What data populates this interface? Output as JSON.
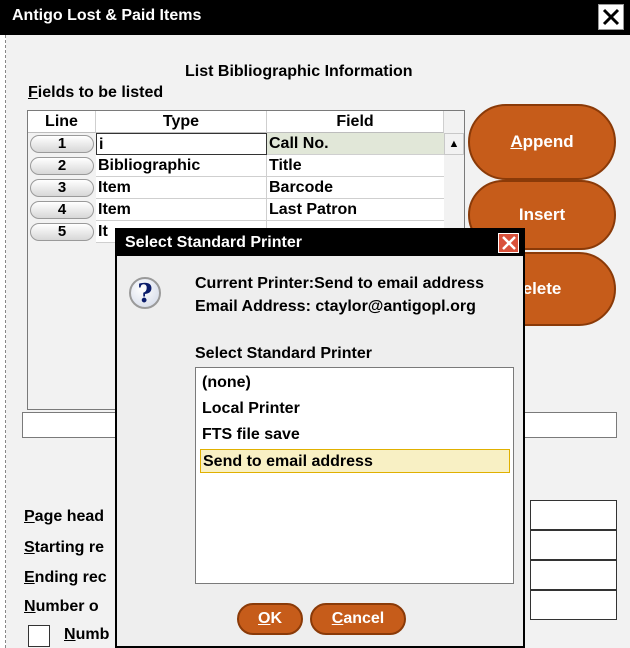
{
  "window": {
    "title": "Antigo Lost & Paid Items"
  },
  "list_heading": "List Bibliographic Information",
  "fields_label": {
    "mnemonic": "F",
    "rest": "ields to be listed"
  },
  "table": {
    "columns": [
      "Line",
      "Type",
      "Field"
    ],
    "rows": [
      {
        "line": "1",
        "type": "i",
        "field": "Call No."
      },
      {
        "line": "2",
        "type": "Bibliographic",
        "field": "Title"
      },
      {
        "line": "3",
        "type": "Item",
        "field": "Barcode"
      },
      {
        "line": "4",
        "type": "Item",
        "field": "Last Patron"
      },
      {
        "line": "5",
        "type": "It",
        "field": ""
      }
    ]
  },
  "buttons": {
    "append": {
      "mnemonic": "A",
      "rest": "ppend"
    },
    "insert": "Insert",
    "delete": "elete"
  },
  "bottom_labels": [
    {
      "mnemonic": "P",
      "rest": "age head"
    },
    {
      "mnemonic": "S",
      "rest": "tarting re"
    },
    {
      "mnemonic": "E",
      "rest": "nding rec"
    },
    {
      "mnemonic": "N",
      "rest": "umber o"
    }
  ],
  "numb_checkbox": {
    "mnemonic": "N",
    "rest": "umb"
  },
  "dialog": {
    "title": "Select Standard Printer",
    "icon": "question-icon",
    "current_printer": "Current Printer:Send to email address",
    "email": "Email Address: ctaylor@antigopl.org",
    "list_heading": "Select Standard Printer",
    "options": [
      "(none)",
      "Local Printer",
      "FTS file save",
      "Send to email address"
    ],
    "selected_option": "Send to email address",
    "ok": {
      "mnemonic": "O",
      "rest": "K"
    },
    "cancel": {
      "mnemonic": "C",
      "rest": "ancel"
    }
  },
  "colors": {
    "accent": "#c65c1a",
    "titlebar": "#000000",
    "selection": "#f8f0c4",
    "close_red": "#d9513b"
  }
}
